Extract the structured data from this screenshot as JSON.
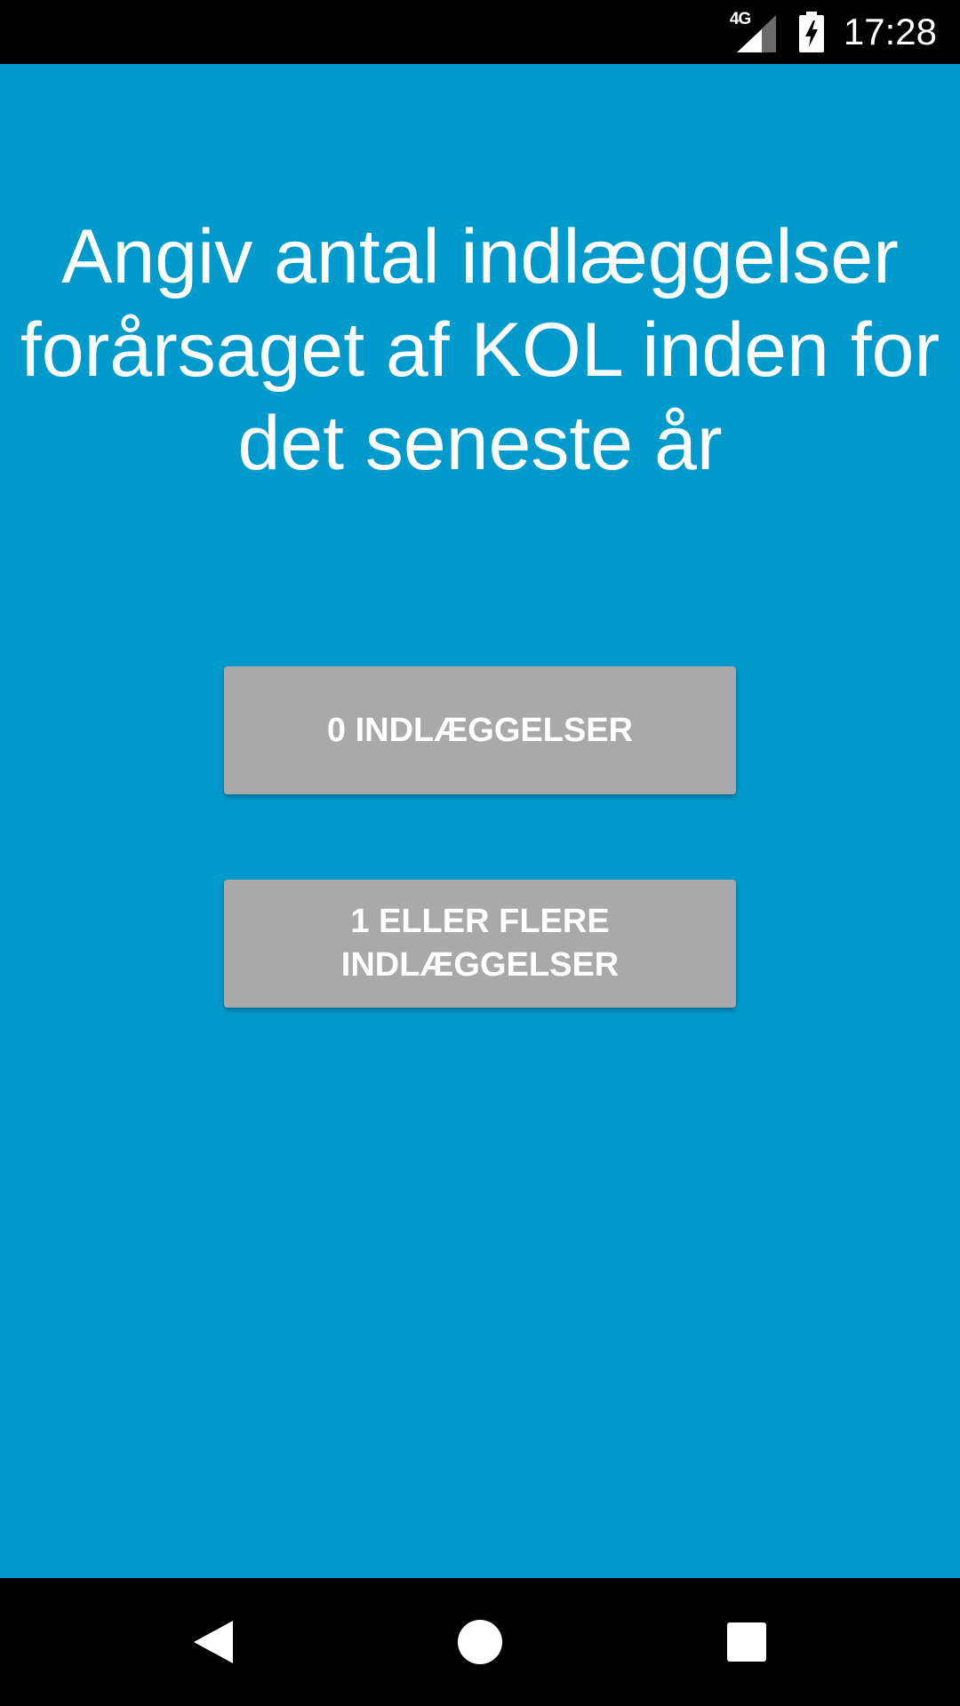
{
  "status_bar": {
    "network_label": "4G",
    "time": "17:28",
    "icons": [
      "signal-icon",
      "battery-charging-icon"
    ]
  },
  "screen": {
    "background_color": "#009ACD",
    "question": "Angiv antal indlæggelser forårsaget af KOL inden for det seneste år"
  },
  "buttons": [
    {
      "label": "0 INDLÆGGELSER"
    },
    {
      "label": "1 ELLER FLERE INDLÆGGELSER"
    }
  ],
  "button_color": "#A9A9A9",
  "nav_bar": {
    "icons": [
      "back-icon",
      "home-icon",
      "recents-icon"
    ]
  }
}
